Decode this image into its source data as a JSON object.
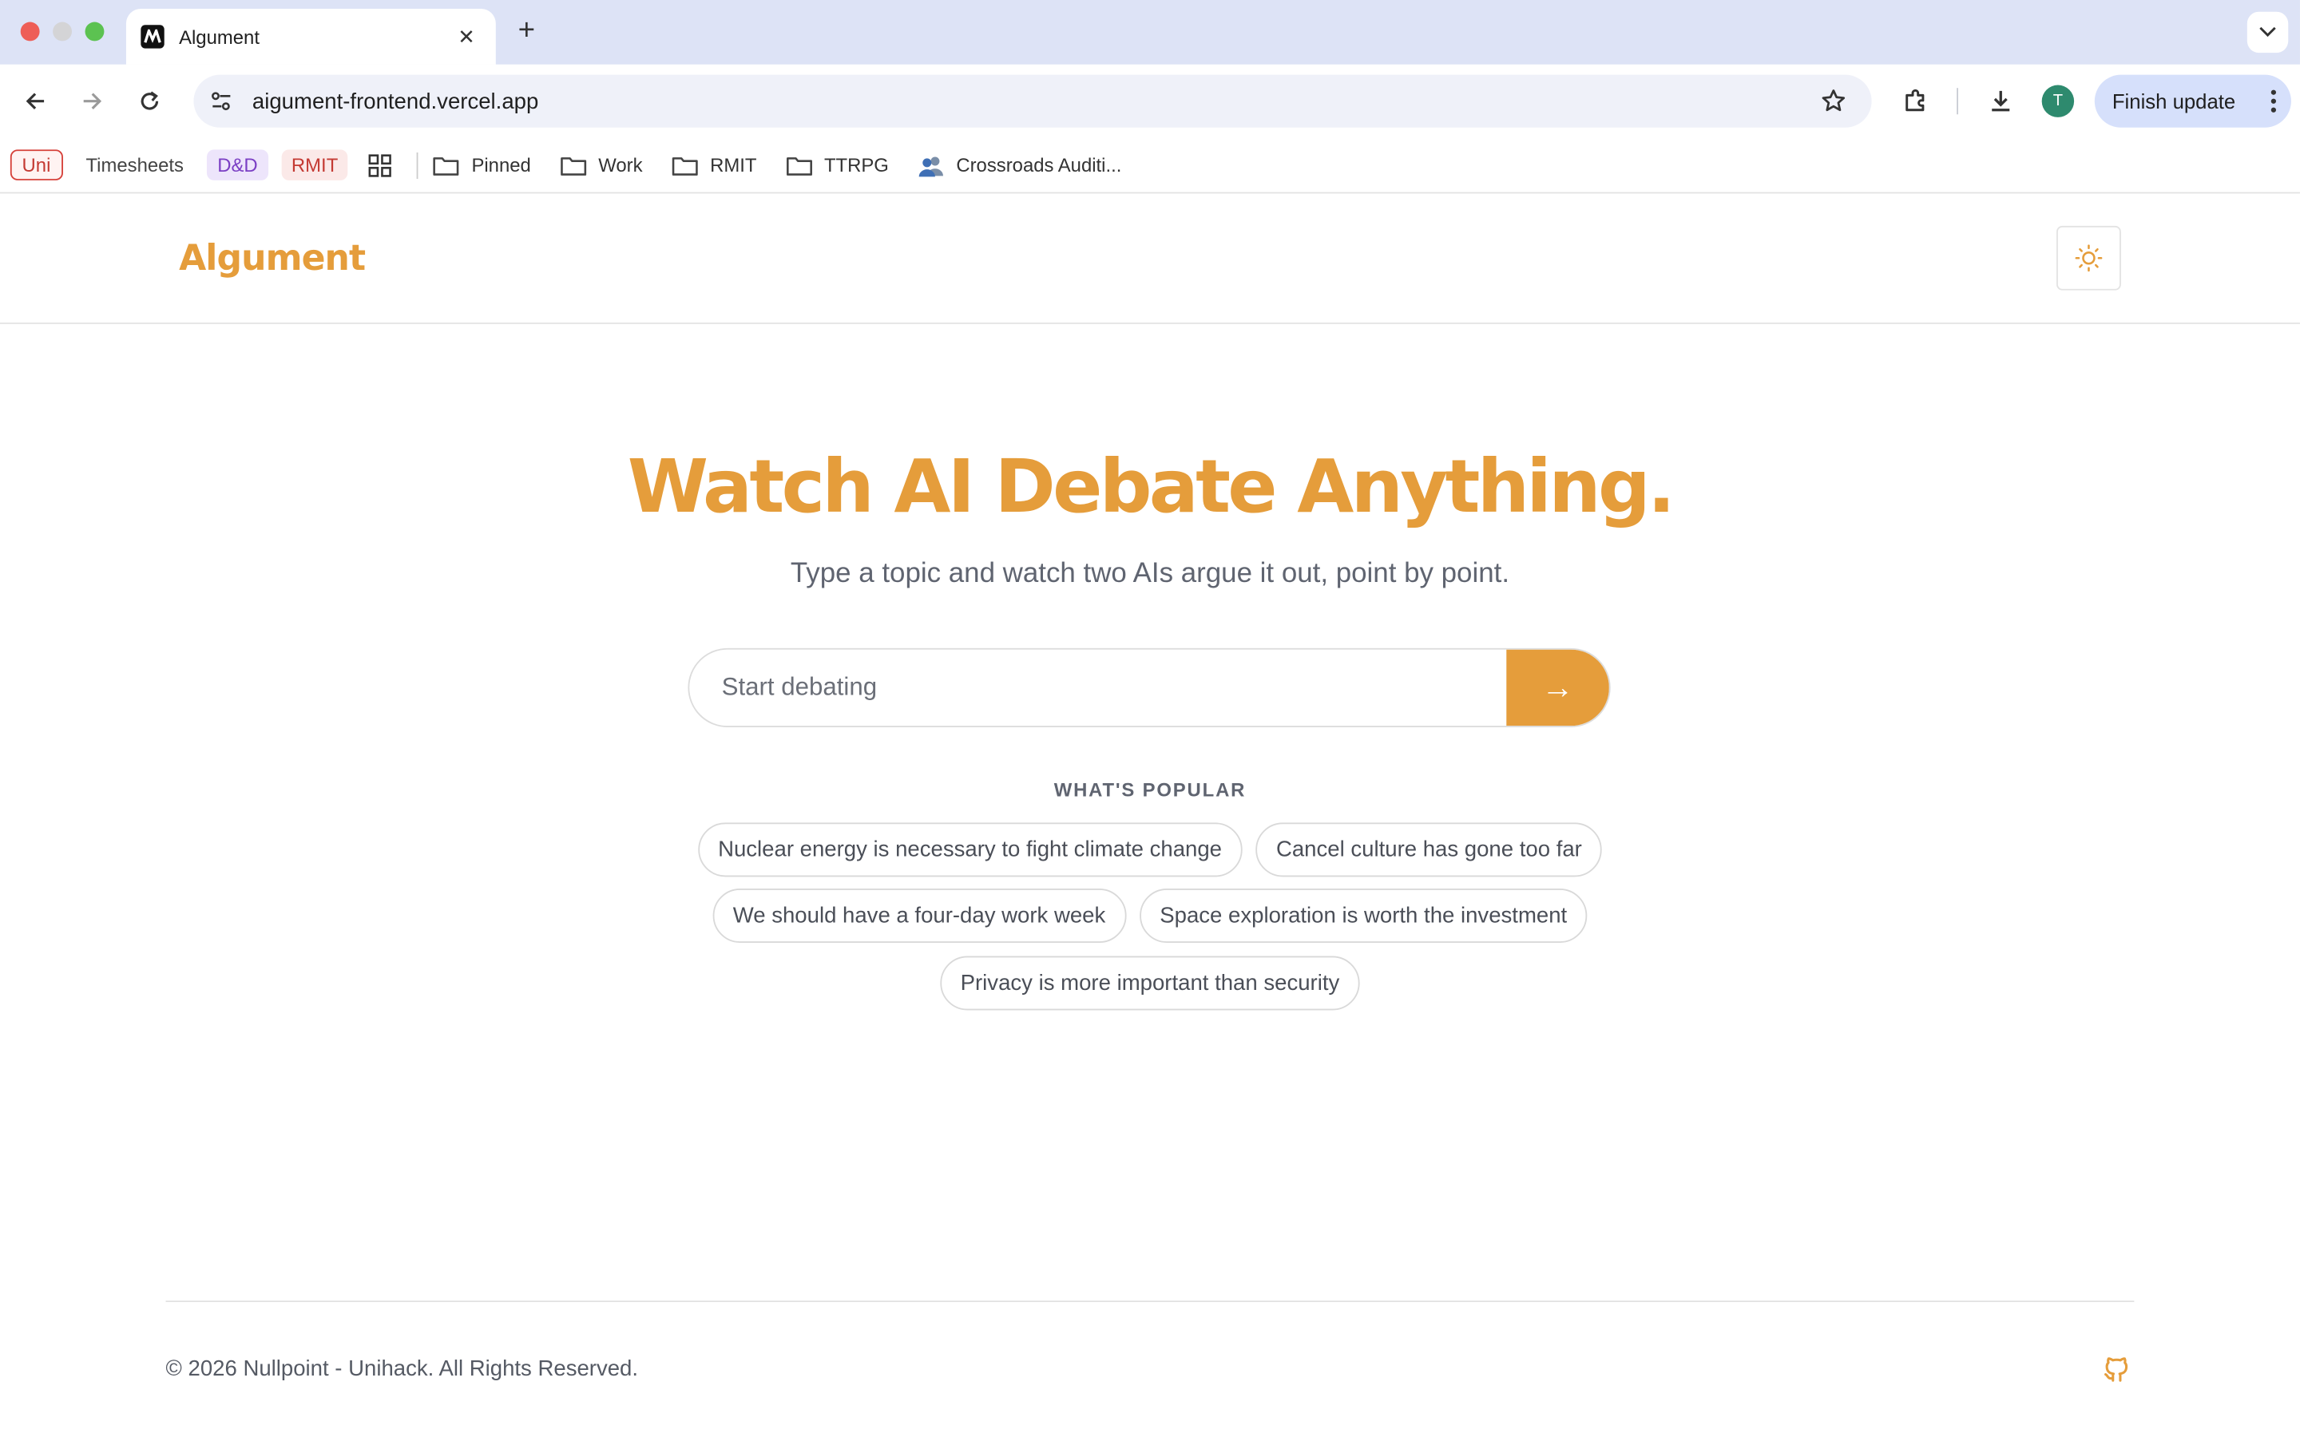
{
  "browser": {
    "tab": {
      "title": "Algument"
    },
    "omnibox": {
      "url": "aigument-frontend.vercel.app"
    },
    "finish_update": "Finish update",
    "avatar_letter": "T",
    "bookmarks": {
      "chips": [
        {
          "label": "Uni"
        },
        {
          "label": "Timesheets"
        },
        {
          "label": "D&D"
        },
        {
          "label": "RMIT"
        }
      ],
      "folders": [
        {
          "label": "Pinned"
        },
        {
          "label": "Work"
        },
        {
          "label": "RMIT"
        },
        {
          "label": "TTRPG"
        }
      ],
      "link": {
        "label": "Crossroads Auditi..."
      }
    }
  },
  "header": {
    "logo": "Algument"
  },
  "hero": {
    "title": "Watch AI Debate Anything.",
    "subtitle": "Type a topic and watch two AIs argue it out, point by point."
  },
  "search": {
    "placeholder": "Start debating",
    "button_label": "→"
  },
  "popular": {
    "label": "WHAT'S POPULAR",
    "topics": [
      "Nuclear energy is necessary to fight climate change",
      "Cancel culture has gone too far",
      "We should have a four-day work week",
      "Space exploration is worth the investment",
      "Privacy is more important than security"
    ]
  },
  "footer": {
    "copyright": "© 2026 Nullpoint - Unihack. All Rights Reserved."
  },
  "colors": {
    "accent": "#e59d3b",
    "tabstrip": "#dde3f6",
    "text_muted": "#5f6470"
  }
}
